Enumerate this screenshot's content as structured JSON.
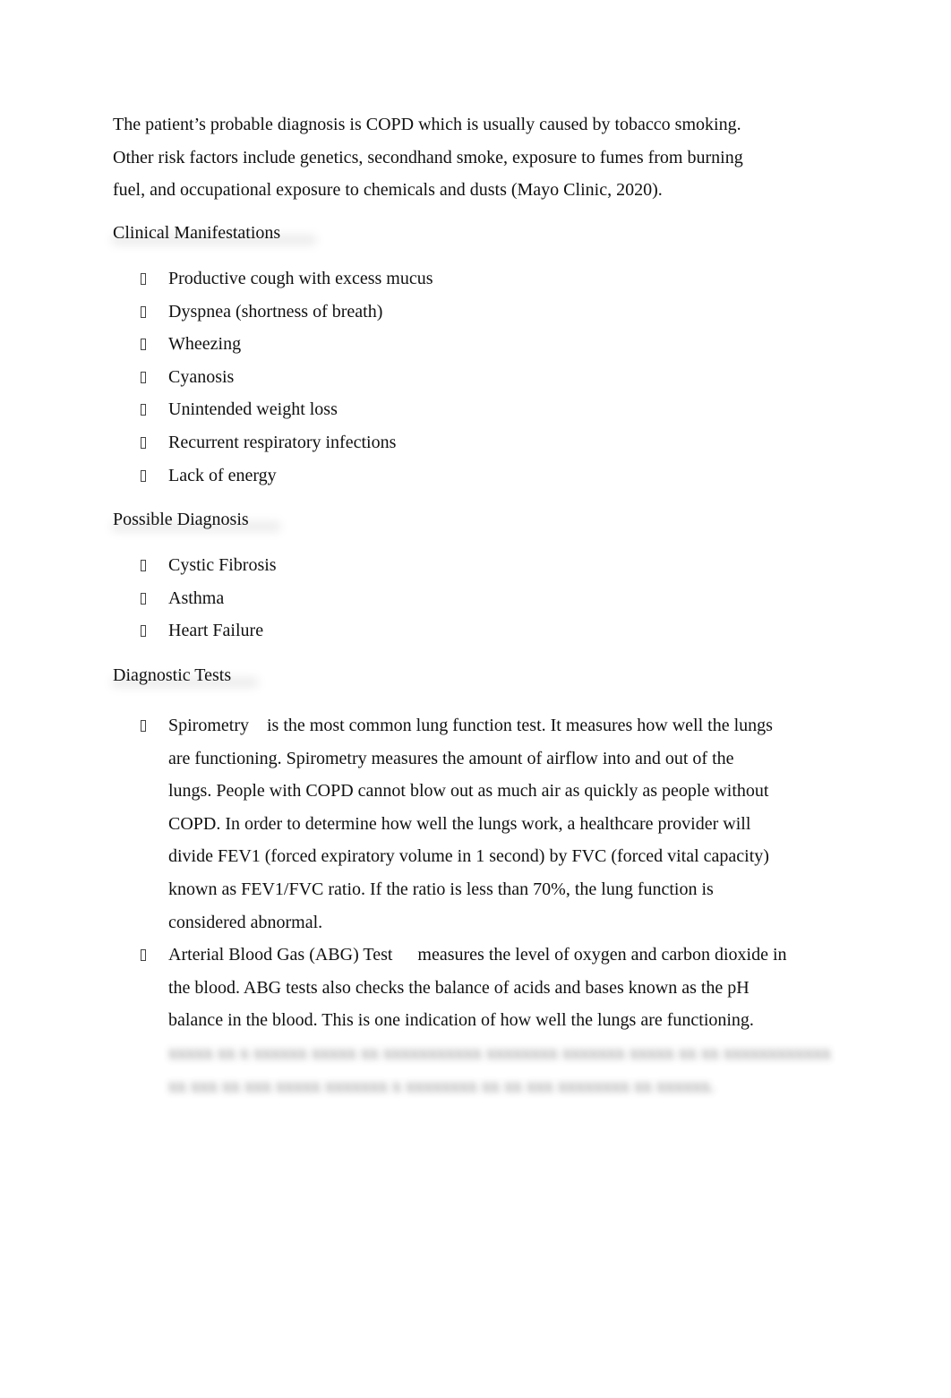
{
  "document": {
    "intro_lines": [
      "The patient’s probable diagnosis is COPD which is usually caused by tobacco smoking.",
      "Other risk factors include genetics, secondhand smoke, exposure to fumes from burning",
      "fuel, and occupational exposure to chemicals and dusts (Mayo Clinic, 2020)."
    ],
    "bullet_icon": "missing-glyph-box",
    "sections": {
      "clinical": {
        "heading": "Clinical Manifestations",
        "items": [
          "Productive cough with excess mucus",
          "Dyspnea (shortness of breath)",
          "Wheezing",
          "Cyanosis",
          "Unintended weight loss",
          "Recurrent respiratory infections",
          "Lack of energy"
        ]
      },
      "possible": {
        "heading": "Possible Diagnosis",
        "items": [
          "Cystic Fibrosis",
          "Asthma",
          "Heart Failure"
        ]
      },
      "tests": {
        "heading": "Diagnostic Tests",
        "items": [
          {
            "term": "Spirometry",
            "lines": [
              "is the most common lung function test. It measures how well the lungs",
              "are functioning. Spirometry measures the amount of airflow into and out of the",
              "lungs. People with COPD cannot blow out as much air as quickly as people without",
              "COPD. In order to determine how well the lungs work, a healthcare provider will",
              "divide FEV1 (forced expiratory volume in 1 second) by FVC (forced vital capacity)",
              "known as FEV1/FVC ratio. If the ratio is less than 70%, the lung function is",
              "considered abnormal."
            ]
          },
          {
            "term": "Arterial Blood Gas (ABG) Test",
            "lines": [
              "measures the level of oxygen and carbon dioxide in",
              "the blood. ABG tests also checks the balance of acids and bases known as the pH",
              "balance in the blood. This is one indication of how well the lungs are functioning."
            ],
            "blurred_lines": [
              "xxxxx xx x xxxxxx xxxxx xx xxxxxxxxxxx xxxxxxxx xxxxxxx xxxxx xx xx xxxxxxxxxxxx",
              "xx xxx xx xxx xxxxx xxxxxxx x xxxxxxxx xx xx xxx xxxxxxxx xx xxxxxx."
            ]
          }
        ]
      }
    }
  }
}
